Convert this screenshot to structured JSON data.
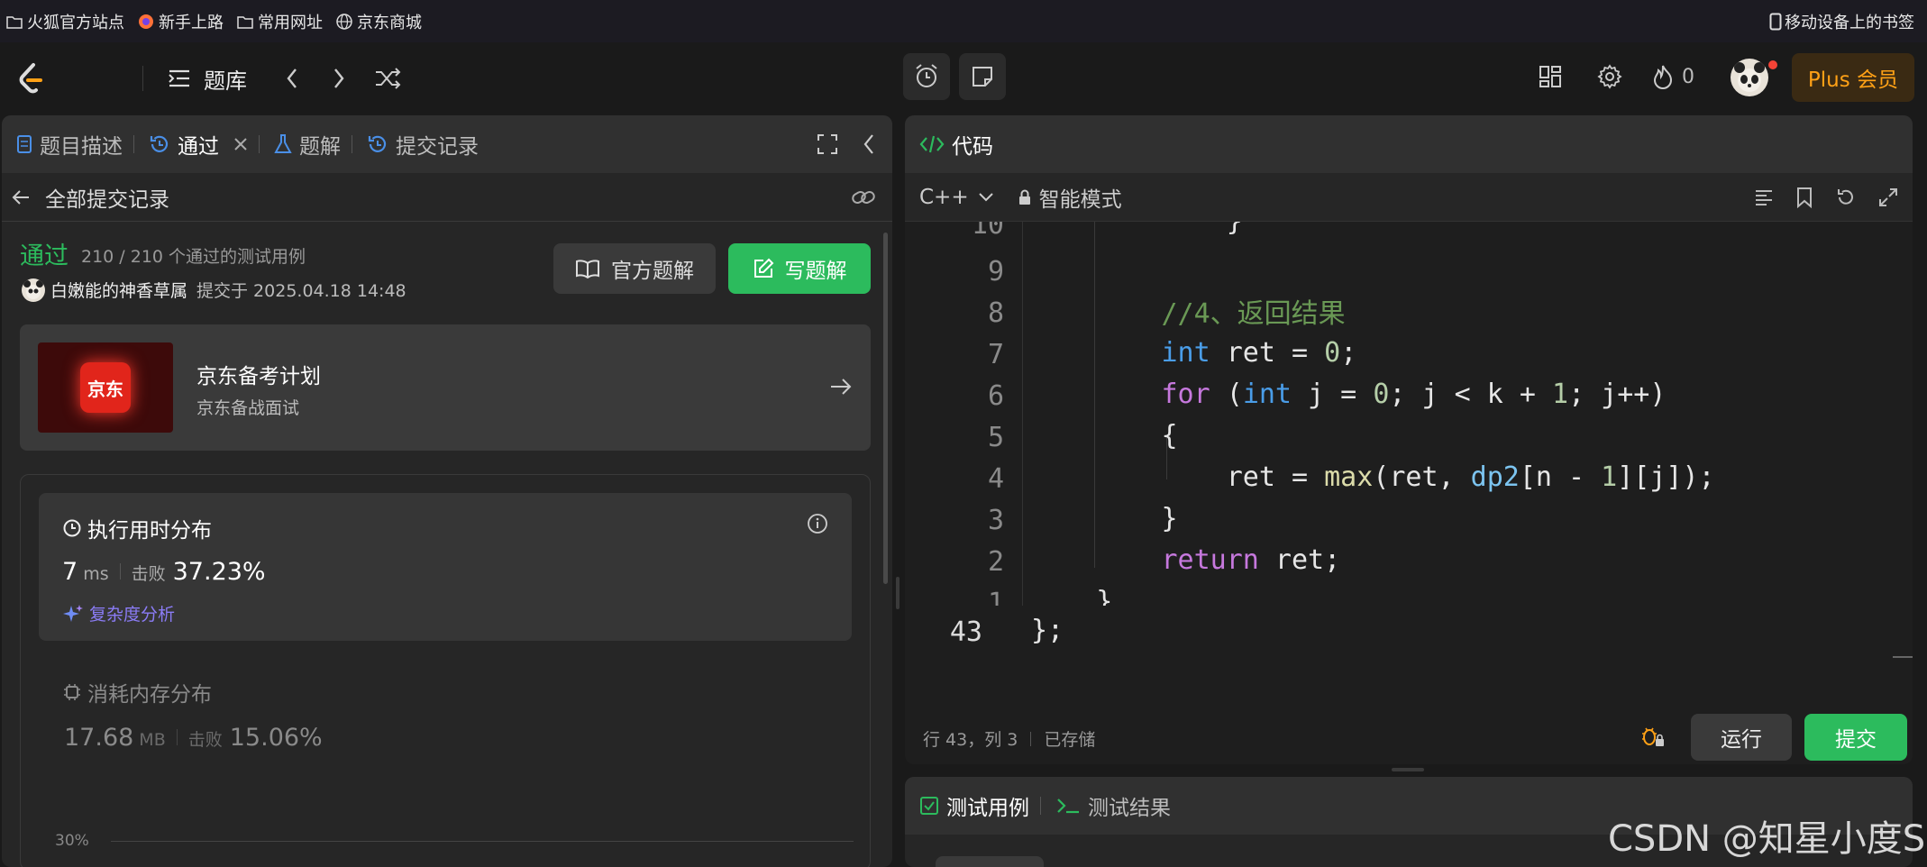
{
  "bookmarks": {
    "items": [
      "火狐官方站点",
      "新手上路",
      "常用网址",
      "京东商城"
    ],
    "mobile": "移动设备上的书签"
  },
  "topbar": {
    "problem_bank": "题库",
    "streak_count": "0",
    "plus_label": "Plus 会员"
  },
  "left_panel": {
    "tabs": [
      "题目描述",
      "通过",
      "题解",
      "提交记录"
    ],
    "back_label": "全部提交记录",
    "status": "通过",
    "cases": "210 / 210 个通过的测试用例",
    "user": "白嫩能的神香草属",
    "submitted_at": "提交于 2025.04.18 14:48",
    "official_btn": "官方题解",
    "write_btn": "写题解",
    "promo": {
      "logo": "京东",
      "title": "京东备考计划",
      "subtitle": "京东备战面试"
    },
    "runtime": {
      "title": "执行用时分布",
      "value": "7",
      "unit": "ms",
      "beat_label": "击败",
      "beat": "37.23%",
      "analysis": "复杂度分析"
    },
    "memory": {
      "title": "消耗内存分布",
      "value": "17.68",
      "unit": "MB",
      "beat_label": "击败",
      "beat": "15.06%"
    },
    "chart_tick": "30%"
  },
  "editor": {
    "tab_label": "代码",
    "language": "C++",
    "mode": "智能模式",
    "status_pos": "行 43，列 3",
    "status_saved": "已存储",
    "run_btn": "运行",
    "submit_btn": "提交"
  },
  "bottom_panel": {
    "tabs": [
      "测试用例",
      "测试结果"
    ]
  },
  "watermark": "CSDN @知星小度S",
  "colors": {
    "accent_green": "#2cbb5d",
    "plus_gold": "#ffa116",
    "jd_red": "#e1251b"
  }
}
